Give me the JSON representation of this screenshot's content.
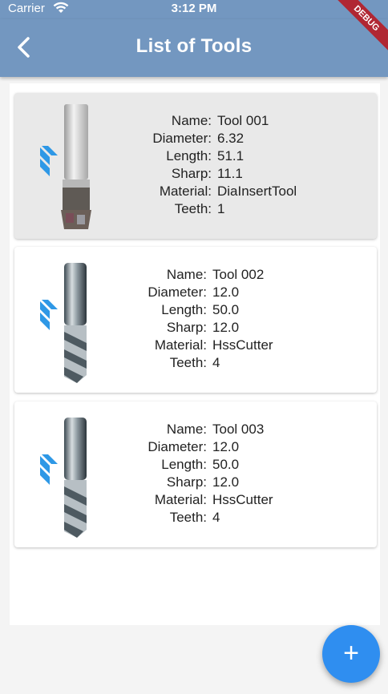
{
  "status": {
    "carrier": "Carrier",
    "time": "3:12 PM"
  },
  "appbar": {
    "title": "List of Tools",
    "debug_label": "DEBUG"
  },
  "labels": {
    "name": "Name:",
    "diameter": "Diameter:",
    "length": "Length:",
    "sharp": "Sharp:",
    "material": "Material:",
    "teeth": "Teeth:"
  },
  "tools": [
    {
      "name": "Tool 001",
      "diameter": "6.32",
      "length": "51.1",
      "sharp": "11.1",
      "material": "DiaInsertTool",
      "teeth": "1",
      "image_icon": "insert-end-mill-image"
    },
    {
      "name": "Tool 002",
      "diameter": "12.0",
      "length": "50.0",
      "sharp": "12.0",
      "material": "HssCutter",
      "teeth": "4",
      "image_icon": "spiral-end-mill-image"
    },
    {
      "name": "Tool 003",
      "diameter": "12.0",
      "length": "50.0",
      "sharp": "12.0",
      "material": "HssCutter",
      "teeth": "4",
      "image_icon": "spiral-end-mill-image"
    }
  ],
  "fab": {
    "label": "+"
  },
  "colors": {
    "appbar": "#7397c0",
    "fab": "#2f8ef0",
    "selected_card": "#e9e9e9",
    "debug_banner": "#b02733"
  }
}
